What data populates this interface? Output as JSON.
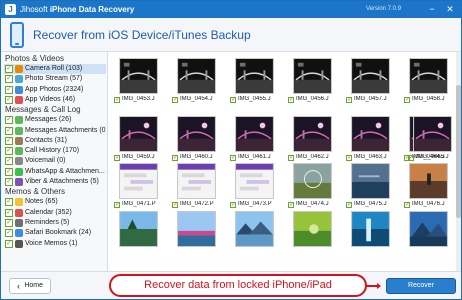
{
  "titlebar": {
    "brand": "Jihosoft",
    "product": "iPhone Data Recovery",
    "version": "Version 7.0.9",
    "controls": [
      "−",
      "✕"
    ]
  },
  "header": {
    "title": "Recover from iOS Device/iTunes Backup"
  },
  "sidebar": {
    "groups": [
      {
        "label": "Photos & Videos",
        "items": [
          {
            "label": "Camera Roll (103)",
            "icon_color": "#e68a00",
            "active": true
          },
          {
            "label": "Photo Stream (57)",
            "icon_color": "#4aa6d9"
          },
          {
            "label": "App Photos (2324)",
            "icon_color": "#3f8bd5"
          },
          {
            "label": "App Videos (46)",
            "icon_color": "#e05050"
          }
        ]
      },
      {
        "label": "Messages & Call Log",
        "items": [
          {
            "label": "Messages (26)",
            "icon_color": "#5cb85c"
          },
          {
            "label": "Messages Attachments (0)",
            "icon_color": "#5cb85c"
          },
          {
            "label": "Contacts (31)",
            "icon_color": "#9b7b55"
          },
          {
            "label": "Call History (170)",
            "icon_color": "#5cb85c"
          },
          {
            "label": "Voicemail (0)",
            "icon_color": "#888888"
          },
          {
            "label": "WhatsApp & Attachmen...",
            "icon_color": "#3fbf4d"
          },
          {
            "label": "Viber & Attachments (5)",
            "icon_color": "#7d52b5"
          }
        ]
      },
      {
        "label": "Memos & Others",
        "items": [
          {
            "label": "Notes (65)",
            "icon_color": "#f1c232"
          },
          {
            "label": "Calendar (352)",
            "icon_color": "#d9534f"
          },
          {
            "label": "Reminders (5)",
            "icon_color": "#6f6f6f"
          },
          {
            "label": "Safari Bookmark (24)",
            "icon_color": "#3a8ee6"
          },
          {
            "label": "Voice Memos (1)",
            "icon_color": "#555555"
          }
        ]
      }
    ]
  },
  "gallery": {
    "items": [
      {
        "label": "IMG_0453.J",
        "thumb": "dark-bridge"
      },
      {
        "label": "IMG_0454.J",
        "thumb": "dark-bridge"
      },
      {
        "label": "IMG_0455.J",
        "thumb": "dark-bridge"
      },
      {
        "label": "IMG_0456.J",
        "thumb": "dark-bridge"
      },
      {
        "label": "IMG_0457.J",
        "thumb": "dark-bridge"
      },
      {
        "label": "IMG_0458.J",
        "thumb": "dark-bridge"
      },
      {
        "label": "IMG_0459.J",
        "thumb": "night-pink"
      },
      {
        "label": "IMG_0460.J",
        "thumb": "night-pink"
      },
      {
        "label": "IMG_0461.J",
        "thumb": "night-pink"
      },
      {
        "label": "IMG_0462.J",
        "thumb": "night-pink"
      },
      {
        "label": "IMG_0463.J",
        "thumb": "night-pink"
      },
      {
        "label": "IMG_0464.J",
        "thumb": "night-pink"
      },
      {
        "label": "IMG_0465.J",
        "thumb": "night-pink"
      },
      {
        "label": "IMG_0471.P",
        "thumb": "chat"
      },
      {
        "label": "IMG_0472.P",
        "thumb": "chat"
      },
      {
        "label": "IMG_0473.P",
        "thumb": "chat"
      },
      {
        "label": "IMG_0474.J",
        "thumb": "grass"
      },
      {
        "label": "IMG_0475.J",
        "thumb": "ocean"
      },
      {
        "label": "IMG_0476.J",
        "thumb": "sunset"
      },
      {
        "label": "",
        "thumb": "forest"
      },
      {
        "label": "",
        "thumb": "sky-pink"
      },
      {
        "label": "",
        "thumb": "lake"
      },
      {
        "label": "",
        "thumb": "green"
      },
      {
        "label": "",
        "thumb": "waterfall"
      },
      {
        "label": "",
        "thumb": "blue-mountain"
      }
    ]
  },
  "footer": {
    "home_label": "Home",
    "recover_label": "Recover",
    "annotation": "Recover data from locked iPhone/iPad"
  },
  "colors": {
    "titlebar": "#1b76c9",
    "accent": "#1f5ea8",
    "check": "#6ea52e",
    "annotation": "#d5121c"
  }
}
